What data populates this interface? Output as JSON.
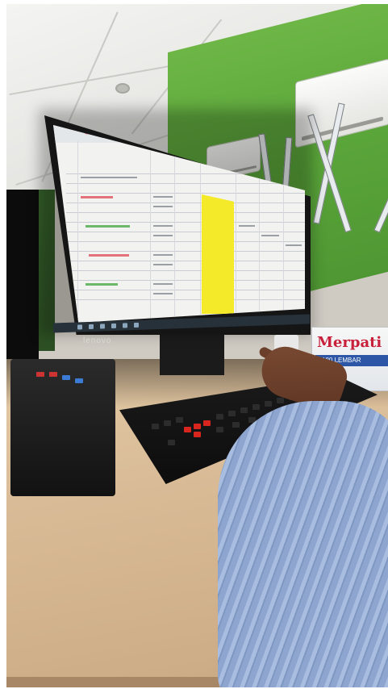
{
  "scene": {
    "monitor": {
      "brand": "lenovo"
    },
    "tissue_box": {
      "brand": "Merpati",
      "subtitle": "180 LEMBAR"
    },
    "colors": {
      "wall": "#5aa53a",
      "highlight": "#f5ea2a",
      "desk": "#d7b994",
      "sleeve": "#8ea6cf",
      "tissue_brand": "#c8203a"
    },
    "icons": [
      "monitor-icon",
      "keyboard-icon",
      "air-conditioner-icon",
      "tissue-box-icon"
    ]
  }
}
